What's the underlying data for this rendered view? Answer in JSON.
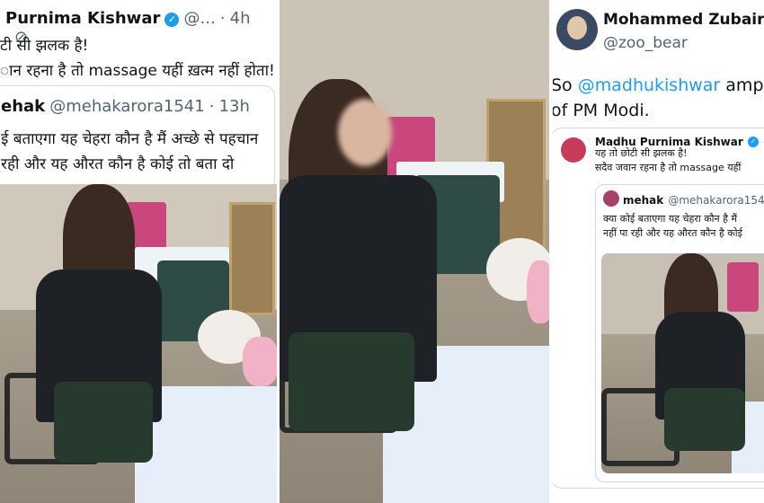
{
  "left_tweet": {
    "author_name": "Purnima Kishwar",
    "author_handle": "@...",
    "time": "4h",
    "line1": "टी सी झलक है!",
    "line2": "ान रहना है तो  massage यहीं ख़त्म नहीं होता!"
  },
  "left_quote": {
    "author_name": "ehak",
    "author_handle": "@mehakarora1541",
    "time": "13h",
    "line1": "ई बताएगा यह चेहरा कौन है मैं अच्छे से पहचान",
    "line2": "रही और यह औरत कौन है कोई तो बता दो"
  },
  "right_tweet": {
    "author_name": "Mohammed Zubair",
    "author_handle": "@zoo_bear",
    "mention": "@madhukishwar",
    "line1_tail": " ampl",
    "line1_head": "So ",
    "line2": "of PM Modi."
  },
  "right_quote": {
    "author_name": "Madhu Purnima Kishwar",
    "author_handle": "@",
    "line1": "यह तो छोटी सी झलक है!",
    "line2": "सदैव जवान रहना है तो  massage यहीं"
  },
  "right_inner_quote": {
    "author_name": "mehak",
    "author_handle": "@mehakarora154",
    "line1": "क्या कोई बताएगा यह चेहरा कौन है मैं",
    "line2": "नहीं पा रही और यह औरत कौन है कोई"
  },
  "colors": {
    "accent": "#1d9bf0",
    "text": "#0f1419",
    "muted": "#536471"
  }
}
